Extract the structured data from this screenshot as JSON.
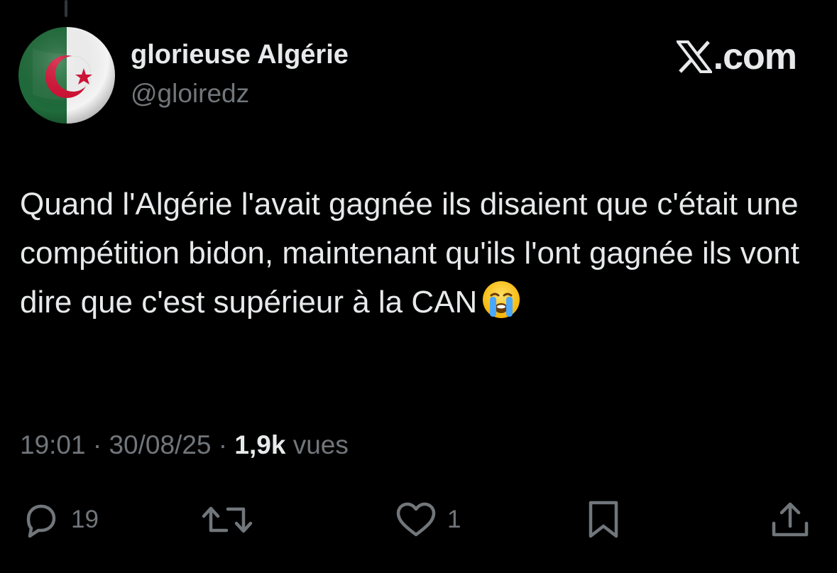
{
  "post": {
    "author": {
      "display_name": "glorieuse Algérie",
      "handle": "@gloiredz",
      "avatar_icon": "algeria-flag-icon"
    },
    "brand": {
      "icon": "x-logo-icon",
      "text": ".com"
    },
    "text": "Quand l'Algérie l'avait gagnée ils disaient que c'était une compétition bidon, maintenant qu'ils l'ont gagnée ils vont dire que c'est supérieur à la CAN",
    "emoji_icon": "loudly-crying-face-icon",
    "meta": {
      "time": "19:01",
      "separator": " · ",
      "date": "30/08/25",
      "views_count": "1,9k",
      "views_label": "vues"
    },
    "actions": {
      "replies": {
        "icon": "reply-icon",
        "count": "19"
      },
      "reposts": {
        "icon": "repost-icon",
        "count": ""
      },
      "likes": {
        "icon": "heart-icon",
        "count": "1"
      },
      "bookmark": {
        "icon": "bookmark-icon"
      },
      "share": {
        "icon": "share-icon"
      }
    }
  },
  "colors": {
    "background": "#000000",
    "primary_text": "#e7e9ea",
    "secondary_text": "#71767b",
    "flag_green": "#1f6b3a",
    "flag_white": "#ffffff",
    "flag_red": "#d21034"
  }
}
